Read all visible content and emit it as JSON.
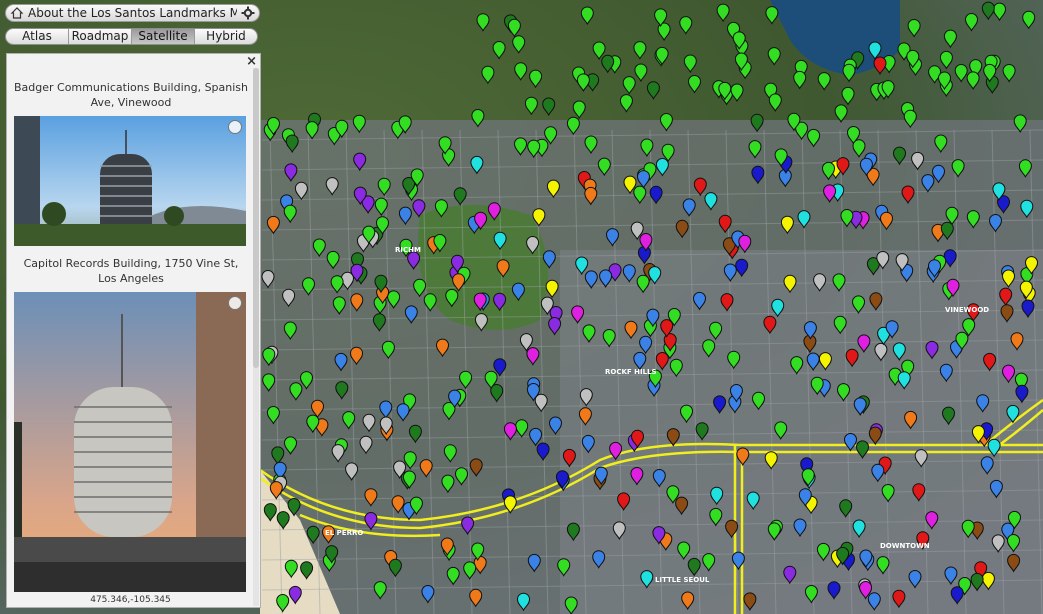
{
  "window": {
    "title": "About the Los Santos Landmarks Map"
  },
  "tabs": [
    {
      "label": "Atlas",
      "active": false
    },
    {
      "label": "Roadmap",
      "active": false
    },
    {
      "label": "Satellite",
      "active": true
    },
    {
      "label": "Hybrid",
      "active": false
    }
  ],
  "panel": {
    "close_label": "×",
    "entries": [
      {
        "caption": "Badger Communications Building, Spanish Ave, Vinewood"
      },
      {
        "caption": "Capitol Records Building, 1750 Vine St, Los Angeles"
      }
    ],
    "coords": "475.346,-105.345"
  },
  "map": {
    "labels": [
      "RICHM",
      "VINEWOOD",
      "ROCKF HILLS",
      "EL PERRO",
      "LITTLE SEOUL",
      "DOWNTOWN"
    ]
  },
  "colors": {
    "green": "#33dd22",
    "blue": "#3b82e6",
    "navy": "#1a1acd",
    "purple": "#8a2be2",
    "magenta": "#e020e0",
    "red": "#e01818",
    "orange": "#f07a1a",
    "dark_green": "#1f7a1f",
    "gray": "#c0c0c0",
    "brown": "#8a4b14",
    "cyan": "#20e0e0",
    "yellow": "#f4f400",
    "road": "#f1ee1e"
  }
}
